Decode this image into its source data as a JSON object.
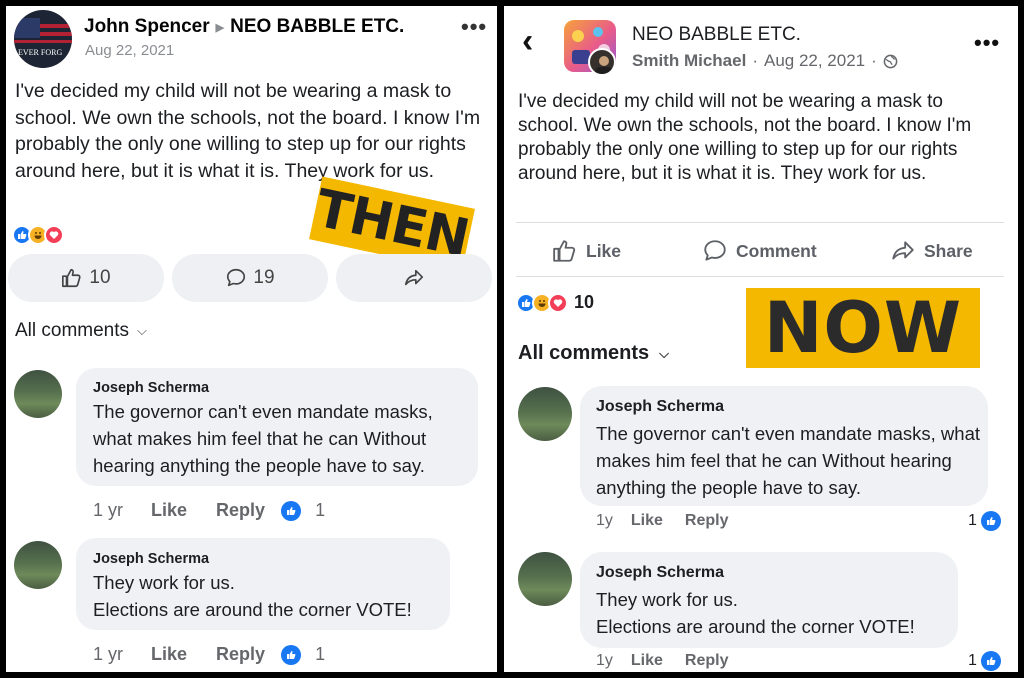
{
  "left": {
    "author": "John Spencer",
    "group": "NEO BABBLE ETC.",
    "date": "Aug 22, 2021",
    "avatar_text": "EVER FORG",
    "post_text": "I've decided my child will not be wearing a mask to school. We own the schools, not the board. I know I'm probably the only one willing to step up for our rights around here, but it is what it is. They work for us.",
    "stamp": "THEN",
    "like_count": "10",
    "comment_count": "19",
    "all_comments": "All comments",
    "comments": [
      {
        "name": "Joseph Scherma",
        "text": "The governor can't even mandate masks, what makes him feel that he can Without hearing anything the people have to say.",
        "time": "1 yr",
        "like": "Like",
        "reply": "Reply",
        "reactions": "1"
      },
      {
        "name": "Joseph Scherma",
        "text": "They work for us.\nElections are around the corner VOTE!",
        "time": "1 yr",
        "like": "Like",
        "reply": "Reply",
        "reactions": "1"
      }
    ]
  },
  "right": {
    "group": "NEO BABBLE ETC.",
    "author": "Smith Michael",
    "date": "Aug 22, 2021",
    "post_text": "I've decided my child will not be wearing a mask to school. We own the schools, not the board. I know I'm probably the only one willing to step up for our rights around here, but it is what it is. They work for us.",
    "actions": {
      "like": "Like",
      "comment": "Comment",
      "share": "Share"
    },
    "reaction_count": "10",
    "stamp": "NOW",
    "all_comments": "All comments",
    "comments": [
      {
        "name": "Joseph Scherma",
        "text": "The governor can't even mandate masks, what makes him feel that he can Without hearing anything the people have to say.",
        "time": "1y",
        "like": "Like",
        "reply": "Reply",
        "reactions": "1"
      },
      {
        "name": "Joseph Scherma",
        "text": "They work for us.\nElections are around the corner VOTE!",
        "time": "1y",
        "like": "Like",
        "reply": "Reply",
        "reactions": "1"
      }
    ]
  },
  "colors": {
    "fb_blue": "#1877f2",
    "love_red": "#f33e58",
    "haha_yellow": "#f7b125",
    "stamp_bg": "#f5b800"
  }
}
